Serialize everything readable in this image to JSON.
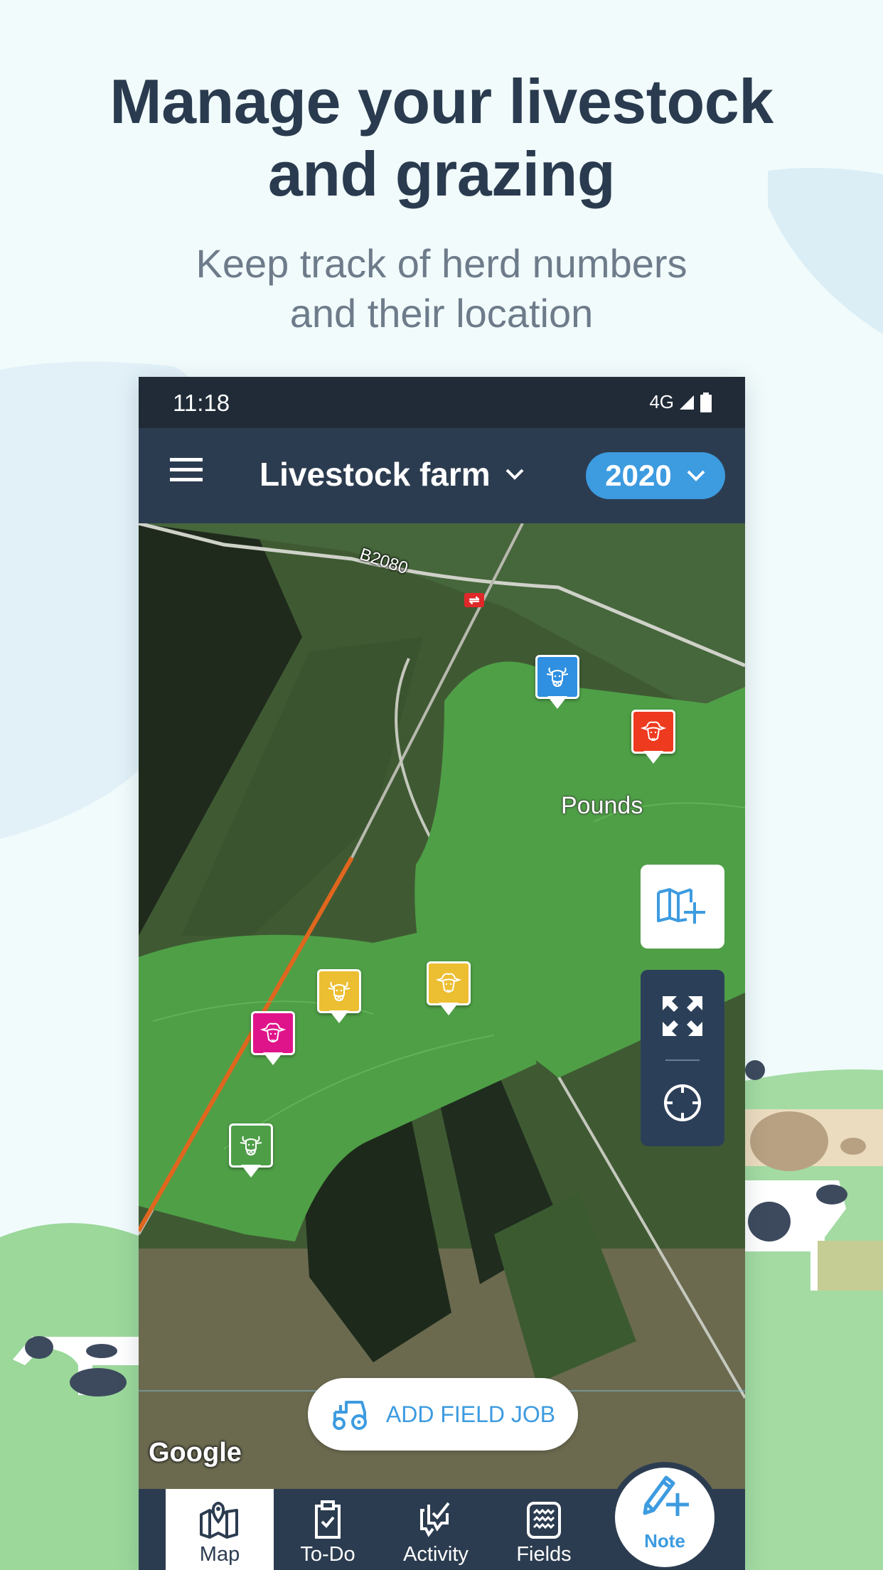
{
  "promo": {
    "headline_line1": "Manage your livestock",
    "headline_line2": "and grazing",
    "subline_line1": "Keep track of herd numbers",
    "subline_line2": "and their location"
  },
  "statusbar": {
    "time": "11:18",
    "network": "4G",
    "signal_icon": "cell-signal-icon",
    "battery_icon": "battery-icon"
  },
  "appbar": {
    "menu_icon": "hamburger-menu-icon",
    "farm_name": "Livestock farm",
    "farm_dropdown_icon": "chevron-down-icon",
    "year": "2020",
    "year_dropdown_icon": "chevron-down-icon"
  },
  "map": {
    "road_label": "B2080",
    "place_label": "Pounds",
    "rail_station_icon": "rail-station-icon",
    "attribution": "Google",
    "markers": [
      {
        "animal": "cattle",
        "icon": "cow-icon",
        "color": "#2f8fe0"
      },
      {
        "animal": "sheep",
        "icon": "sheep-icon",
        "color": "#ee3a1f"
      },
      {
        "animal": "cattle",
        "icon": "cow-icon",
        "color": "#ecbe32"
      },
      {
        "animal": "sheep",
        "icon": "sheep-icon",
        "color": "#ecbe32"
      },
      {
        "animal": "sheep",
        "icon": "sheep-icon",
        "color": "#e0148a"
      },
      {
        "animal": "cattle",
        "icon": "cow-icon",
        "color": "#4e9e48"
      }
    ],
    "controls": {
      "add_field_icon": "map-plus-icon",
      "fullscreen_icon": "expand-arrows-icon",
      "locate_icon": "crosshair-icon"
    },
    "add_field_job": {
      "label": "ADD FIELD JOB",
      "icon": "tractor-icon"
    }
  },
  "bottom_nav": {
    "items": [
      {
        "label": "Map",
        "icon": "map-pin-icon",
        "active": true
      },
      {
        "label": "To-Do",
        "icon": "clipboard-check-icon",
        "active": false
      },
      {
        "label": "Activity",
        "icon": "chat-check-icon",
        "active": false
      },
      {
        "label": "Fields",
        "icon": "waves-field-icon",
        "active": false
      }
    ],
    "note_fab": {
      "label": "Note",
      "icon": "pencil-plus-icon"
    }
  },
  "colors": {
    "accent_blue": "#3d9be0",
    "navy": "#2c3c50",
    "field_green": "#4f9f47",
    "boundary_orange": "#e0661e"
  }
}
